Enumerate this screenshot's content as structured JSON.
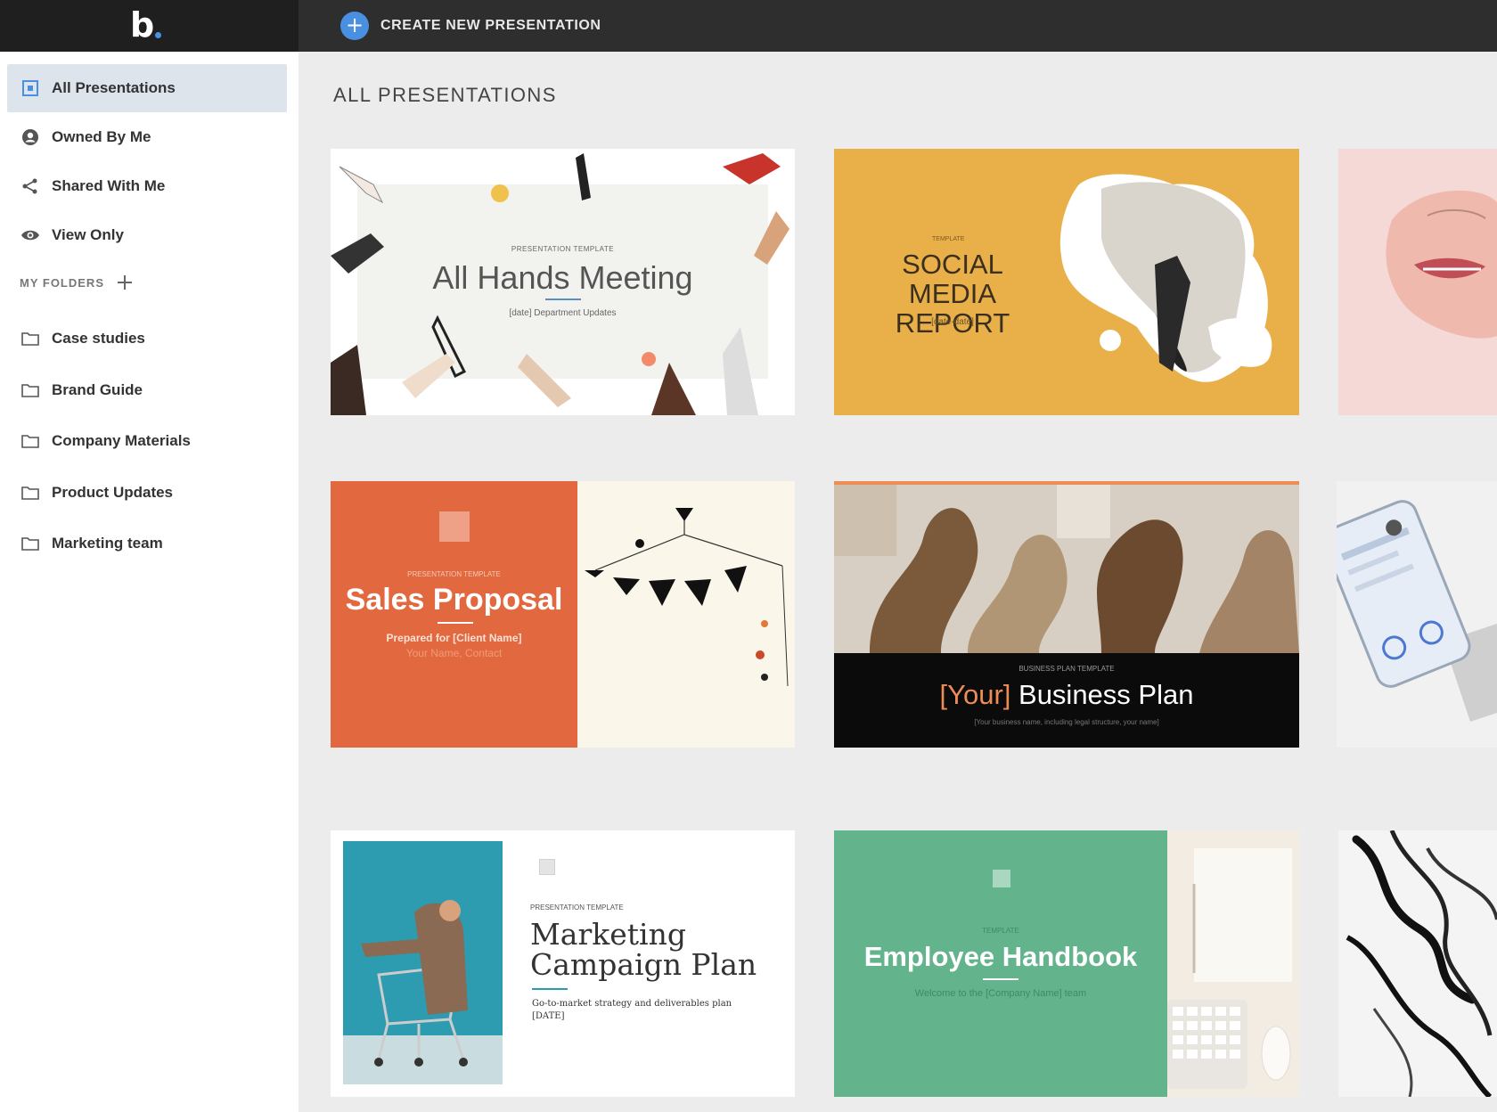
{
  "app": {
    "logo_text": "b",
    "create_button_label": "CREATE NEW PRESENTATION",
    "accent_color": "#4a90e2"
  },
  "sidebar": {
    "nav": [
      {
        "label": "All Presentations",
        "icon": "presentation-icon",
        "active": true
      },
      {
        "label": "Owned By Me",
        "icon": "user-icon"
      },
      {
        "label": "Shared With Me",
        "icon": "share-icon"
      },
      {
        "label": "View Only",
        "icon": "eye-icon"
      }
    ],
    "folders_heading": "MY FOLDERS",
    "folders": [
      {
        "label": "Case studies",
        "icon": "folder-icon"
      },
      {
        "label": "Brand Guide",
        "icon": "folder-icon"
      },
      {
        "label": "Company Materials",
        "icon": "folder-icon"
      },
      {
        "label": "Product Updates",
        "icon": "folder-icon"
      },
      {
        "label": "Marketing team",
        "icon": "folder-icon"
      }
    ]
  },
  "main": {
    "title": "ALL PRESENTATIONS",
    "cards": [
      {
        "kicker": "PRESENTATION TEMPLATE",
        "title": "All Hands Meeting",
        "subtitle": "[date] Department Updates"
      },
      {
        "kicker": "TEMPLATE",
        "title": "SOCIAL MEDIA REPORT",
        "subtitle": "[date-date]"
      },
      {
        "kicker": "",
        "title": "",
        "subtitle": ""
      },
      {
        "kicker": "PRESENTATION TEMPLATE",
        "title": "Sales Proposal",
        "subtitle": "Prepared for [Client Name]",
        "subtitle2": "Your Name, Contact"
      },
      {
        "kicker": "BUSINESS PLAN TEMPLATE",
        "title_accent": "[Your]",
        "title": "Business Plan",
        "subtitle": "[Your business name, including legal structure, your name]"
      },
      {
        "kicker": "",
        "title": "",
        "subtitle": ""
      },
      {
        "kicker": "PRESENTATION TEMPLATE",
        "title": "Marketing Campaign Plan",
        "subtitle": "Go-to-market strategy and deliverables plan",
        "subtitle2": "[DATE]"
      },
      {
        "kicker": "TEMPLATE",
        "title": "Employee Handbook",
        "subtitle": "Welcome to the [Company Name] team"
      },
      {
        "kicker": "",
        "title": "",
        "subtitle": ""
      }
    ]
  }
}
